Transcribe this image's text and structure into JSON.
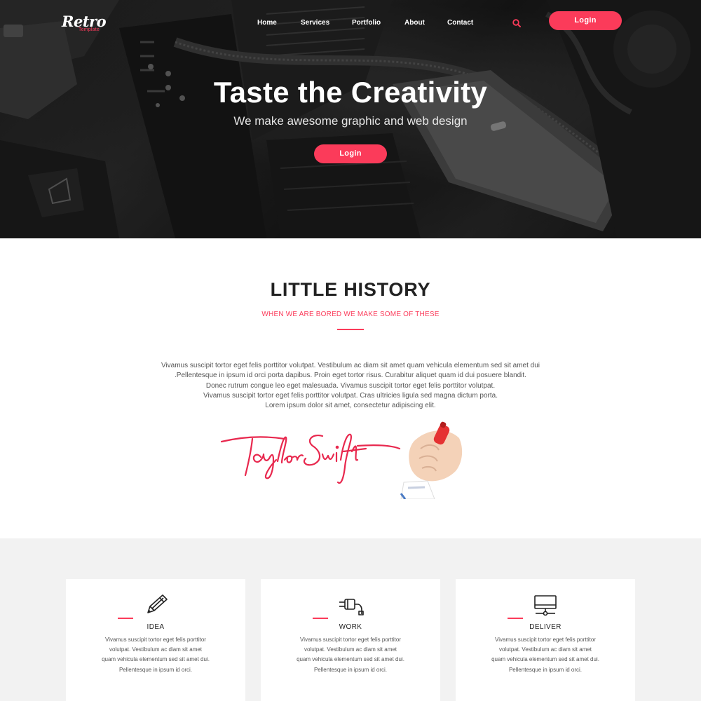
{
  "brand": {
    "name": "Retro",
    "tagline": "Template"
  },
  "nav": {
    "items": [
      "Home",
      "Services",
      "Portfolio",
      "About",
      "Contact"
    ]
  },
  "header": {
    "login_label": "Login",
    "search_icon": "search-icon"
  },
  "hero": {
    "title": "Taste the Creativity",
    "subtitle": "We make awesome graphic and web design",
    "button_label": "Login"
  },
  "history": {
    "title": "LITTLE HISTORY",
    "subtitle": "WHEN WE ARE BORED WE MAKE SOME OF THESE",
    "lines": [
      "Vivamus suscipit tortor eget felis porttitor volutpat. Vestibulum ac diam sit amet quam vehicula elementum sed sit amet dui",
      ".Pellentesque in ipsum id orci porta dapibus. Proin eget tortor risus. Curabitur aliquet quam id dui posuere blandit.",
      "Donec rutrum congue leo eget malesuada. Vivamus suscipit tortor eget felis porttitor volutpat.",
      "Vivamus suscipit tortor eget felis porttitor volutpat. Cras ultricies ligula sed magna dictum porta.",
      "Lorem ipsum dolor sit amet, consectetur adipiscing elit."
    ],
    "signature": "Taylor Swift"
  },
  "features": [
    {
      "title": "IDEA",
      "icon": "pencil-icon",
      "lines": [
        "Vivamus suscipit tortor eget felis porttitor",
        "volutpat. Vestibulum ac diam sit amet",
        "quam vehicula elementum sed sit amet dui.",
        "Pellentesque in ipsum id orci."
      ]
    },
    {
      "title": "WORK",
      "icon": "plug-icon",
      "lines": [
        "Vivamus suscipit tortor eget felis porttitor",
        "volutpat. Vestibulum ac diam sit amet",
        "quam vehicula elementum sed sit amet dui.",
        "Pellentesque in ipsum id orci."
      ]
    },
    {
      "title": "DELIVER",
      "icon": "monitor-icon",
      "lines": [
        "Vivamus suscipit tortor eget felis porttitor",
        "volutpat. Vestibulum ac diam sit amet",
        "quam vehicula elementum sed sit amet dui.",
        "Pellentesque in ipsum id orci."
      ]
    }
  ],
  "colors": {
    "accent": "#fb3b5a",
    "hero_dark": "#1c1c1c",
    "section_gray": "#f2f2f2"
  }
}
